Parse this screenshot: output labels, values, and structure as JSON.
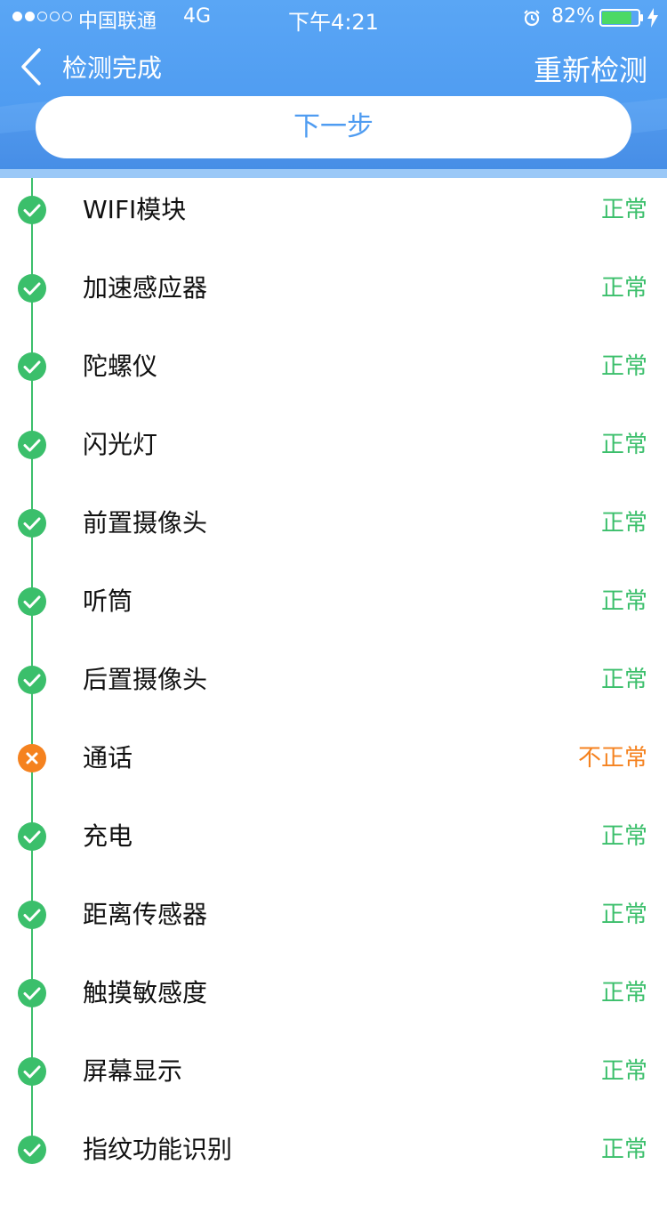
{
  "status_bar": {
    "carrier": "中国联通",
    "network": "4G",
    "time": "下午4:21",
    "battery_percent": "82%",
    "battery_level": 0.82,
    "signal_strength": 2,
    "signal_max": 5
  },
  "navbar": {
    "back_label": "检测完成",
    "retest_label": "重新检测"
  },
  "next_button_label": "下一步",
  "colors": {
    "header_blue": "#4f9cf1",
    "ok_green": "#3bbf6b",
    "error_orange": "#f5821f"
  },
  "items": [
    {
      "label": "WIFI模块",
      "status": "正常",
      "ok": true
    },
    {
      "label": "加速感应器",
      "status": "正常",
      "ok": true
    },
    {
      "label": "陀螺仪",
      "status": "正常",
      "ok": true
    },
    {
      "label": "闪光灯",
      "status": "正常",
      "ok": true
    },
    {
      "label": "前置摄像头",
      "status": "正常",
      "ok": true
    },
    {
      "label": "听筒",
      "status": "正常",
      "ok": true
    },
    {
      "label": "后置摄像头",
      "status": "正常",
      "ok": true
    },
    {
      "label": "通话",
      "status": "不正常",
      "ok": false
    },
    {
      "label": "充电",
      "status": "正常",
      "ok": true
    },
    {
      "label": "距离传感器",
      "status": "正常",
      "ok": true
    },
    {
      "label": "触摸敏感度",
      "status": "正常",
      "ok": true
    },
    {
      "label": "屏幕显示",
      "status": "正常",
      "ok": true
    },
    {
      "label": "指纹功能识别",
      "status": "正常",
      "ok": true
    }
  ]
}
